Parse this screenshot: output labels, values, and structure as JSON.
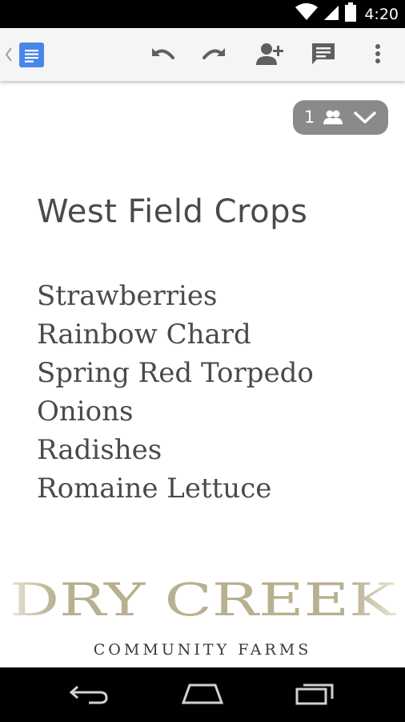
{
  "status_bar": {
    "time": "4:20",
    "icons": [
      "wifi-icon",
      "signal-icon",
      "battery-icon"
    ]
  },
  "toolbar": {
    "back_icon": "chevron-left-icon",
    "app_icon": "google-docs-icon",
    "actions": [
      "undo-icon",
      "redo-icon",
      "add-person-icon",
      "comment-icon",
      "more-vert-icon"
    ]
  },
  "collaborators": {
    "count": "1",
    "icon": "people-icon",
    "expand_icon": "chevron-down-icon"
  },
  "document": {
    "title": "West Field Crops",
    "crops": [
      "Strawberries",
      "Rainbow Chard",
      "Spring Red Torpedo",
      "Onions",
      "Radishes",
      "Romaine Lettuce"
    ],
    "logo": {
      "name": "DRY CREEK",
      "tagline": "COMMUNITY FARMS"
    }
  },
  "nav_bar": {
    "icons": [
      "back-icon",
      "home-icon",
      "recents-icon"
    ]
  },
  "colors": {
    "status_bar": "#000000",
    "toolbar": "#f5f5f5",
    "docs_blue": "#4a86e8",
    "icon_gray": "#5f5f5f",
    "text": "#4a4a4a",
    "collab_pill": "#8a8a8a",
    "logo_gold": "#b8b090"
  }
}
